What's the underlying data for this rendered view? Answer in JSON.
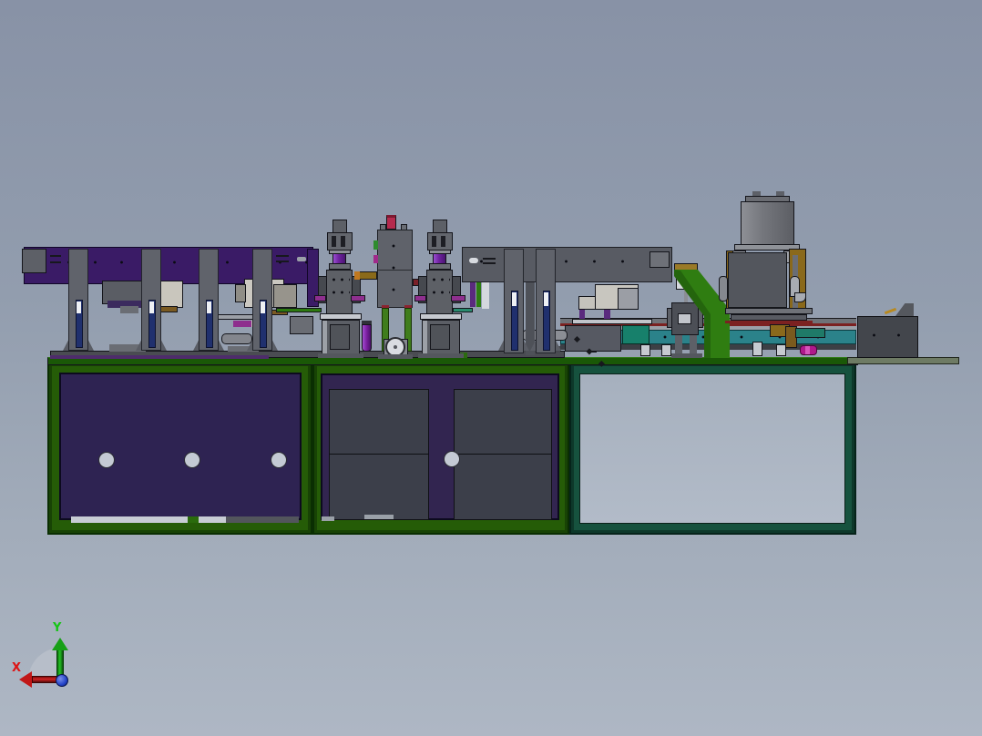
{
  "viewport": {
    "type": "cad-3d-viewport",
    "view": "side elevation",
    "subject": "automated assembly line machine mounted on a green two-bay cabinet table with an open teal frame extension",
    "triad": {
      "x_label": "X",
      "y_label": "Y",
      "x_color": "#c11717",
      "y_color": "#15b515",
      "origin_color": "#2343c8"
    },
    "palette": {
      "background_top": "#8892a6",
      "background_bottom": "#aeb7c4",
      "beam_purple": "#3a1b66",
      "cabinet_frame_green": "#255c07",
      "cabinet_panel_purple": "#2e2352",
      "cabinet_door_gray": "#3c3f4a",
      "right_frame_teal": "#16523e",
      "tabletop_green": "#1a5807",
      "conveyor_teal": "#2b828a",
      "conveyor_red_stripe": "#7c2121",
      "chute_green": "#2f7d11",
      "press_cylinder_purple": "#6f22a0",
      "feeder_cap_red": "#b52a4e",
      "leg_green": "#3f7d1c",
      "gold_column": "#8a691b",
      "magenta_accent": "#af198b",
      "structural_gray": "#60636b"
    },
    "components": [
      {
        "name": "left-gantry-beam",
        "color": "#3a1b66"
      },
      {
        "name": "support-columns-with-linear-guides",
        "color": "#60636b"
      },
      {
        "name": "press-station-1",
        "color": "#5d6066"
      },
      {
        "name": "press-station-2",
        "color": "#5d6066"
      },
      {
        "name": "center-feeder-with-wheel",
        "color": "#5f626a"
      },
      {
        "name": "right-gantry-beam",
        "color": "#585b63"
      },
      {
        "name": "tool-carriage",
        "color": "#c8c6bf"
      },
      {
        "name": "conveyor",
        "color": "#2b828a"
      },
      {
        "name": "transfer-chute",
        "color": "#2f7d11"
      },
      {
        "name": "press-unit-with-motor",
        "color": "#75777d"
      },
      {
        "name": "outfeed-box",
        "color": "#43464c"
      },
      {
        "name": "left-cabinet",
        "color": "#255c07"
      },
      {
        "name": "center-cabinet",
        "color": "#255c07"
      },
      {
        "name": "open-frame-right",
        "color": "#16523e"
      },
      {
        "name": "view-orientation-triad",
        "color": "#2343c8"
      }
    ]
  }
}
